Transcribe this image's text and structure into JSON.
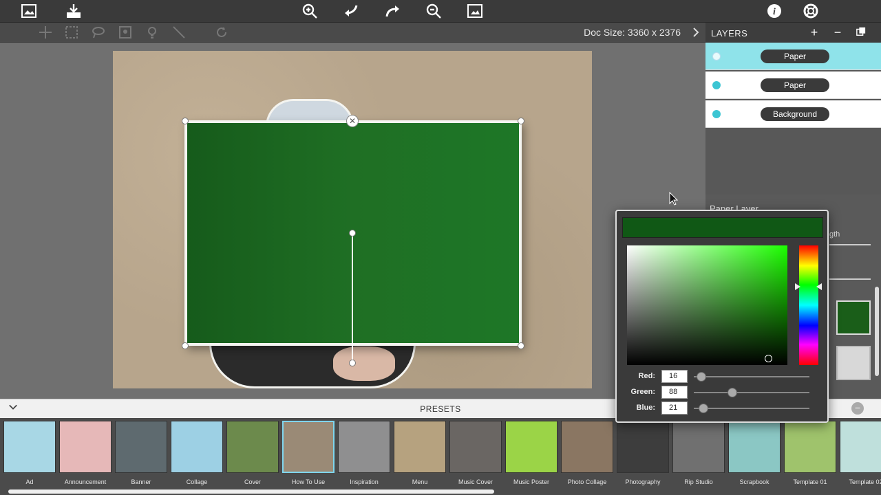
{
  "toolbar": {
    "doc_size": "Doc Size: 3360 x 2376"
  },
  "layers": {
    "title": "LAYERS",
    "add_label": "+",
    "remove_label": "−",
    "items": [
      {
        "label": "Paper",
        "selected": true
      },
      {
        "label": "Paper",
        "selected": false
      },
      {
        "label": "Background",
        "selected": false
      }
    ]
  },
  "properties": {
    "title": "Paper Layer",
    "partial_text": "gth"
  },
  "color_picker": {
    "preview_color": "#105815",
    "red_label": "Red:",
    "red_value": "16",
    "green_label": "Green:",
    "green_value": "88",
    "blue_label": "Blue:",
    "blue_value": "21"
  },
  "presets": {
    "title": "PRESETS",
    "items": [
      {
        "label": "Ad",
        "color": "#a8d7e5"
      },
      {
        "label": "Announcement",
        "color": "#e6b8b8"
      },
      {
        "label": "Banner",
        "color": "#5e6a6f"
      },
      {
        "label": "Collage",
        "color": "#9dd0e4"
      },
      {
        "label": "Cover",
        "color": "#6c8a4c"
      },
      {
        "label": "How To Use",
        "color": "#9a8a76"
      },
      {
        "label": "Inspiration",
        "color": "#8f8f90"
      },
      {
        "label": "Menu",
        "color": "#b6a27f"
      },
      {
        "label": "Music Cover",
        "color": "#6a6663"
      },
      {
        "label": "Music Poster",
        "color": "#9bd447"
      },
      {
        "label": "Photo Collage",
        "color": "#8a7662"
      },
      {
        "label": "Photography",
        "color": "#3d3d3d"
      },
      {
        "label": "Rip Studio",
        "color": "#707070"
      },
      {
        "label": "Scrapbook",
        "color": "#8bc7c4"
      },
      {
        "label": "Template 01",
        "color": "#9fc36c"
      },
      {
        "label": "Template 02",
        "color": "#bfe0dc"
      }
    ]
  },
  "colors": {
    "accent": "#3cc5d3",
    "paper_green": "#1a5e19",
    "selected_layer": "#8fe3ea"
  }
}
